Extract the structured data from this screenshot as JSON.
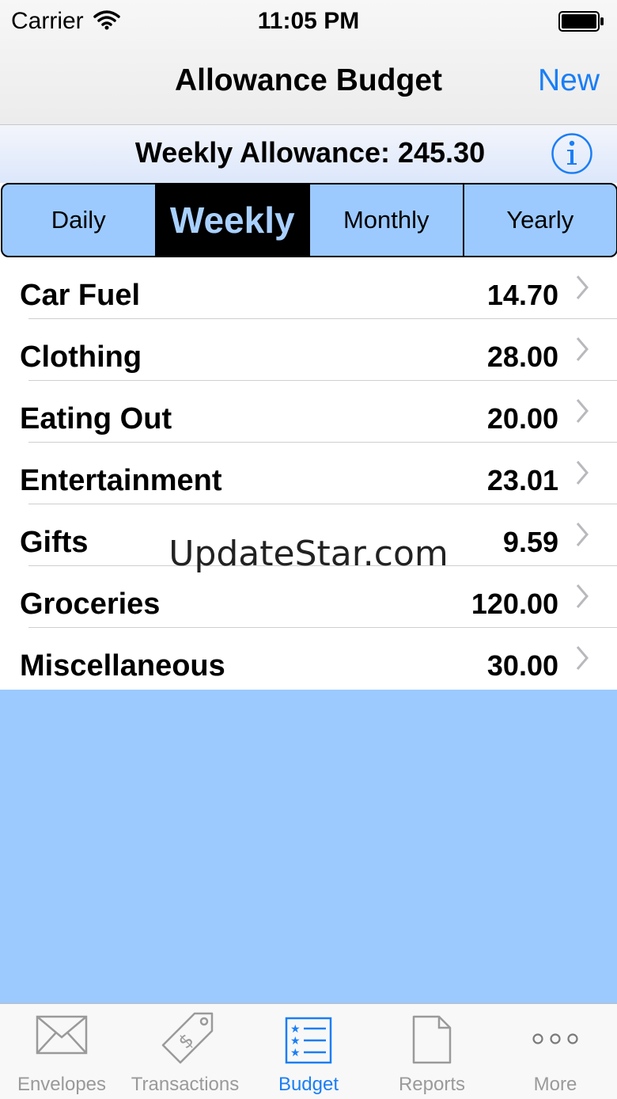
{
  "status": {
    "carrier": "Carrier",
    "time": "11:05 PM"
  },
  "nav": {
    "title": "Allowance Budget",
    "new_label": "New"
  },
  "allowance": {
    "text": "Weekly Allowance: 245.30"
  },
  "segments": [
    "Daily",
    "Weekly",
    "Monthly",
    "Yearly"
  ],
  "selected_segment": "Weekly",
  "budget_items": [
    {
      "name": "Car Fuel",
      "amount": "14.70"
    },
    {
      "name": "Clothing",
      "amount": "28.00"
    },
    {
      "name": "Eating Out",
      "amount": "20.00"
    },
    {
      "name": "Entertainment",
      "amount": "23.01"
    },
    {
      "name": "Gifts",
      "amount": "9.59"
    },
    {
      "name": "Groceries",
      "amount": "120.00"
    },
    {
      "name": "Miscellaneous",
      "amount": "30.00"
    }
  ],
  "watermark": "UpdateStar.com",
  "tabs": [
    {
      "label": "Envelopes",
      "icon": "envelope-icon"
    },
    {
      "label": "Transactions",
      "icon": "price-tag-icon"
    },
    {
      "label": "Budget",
      "icon": "budget-list-icon"
    },
    {
      "label": "Reports",
      "icon": "document-icon"
    },
    {
      "label": "More",
      "icon": "more-dots-icon"
    }
  ],
  "active_tab": "Budget",
  "colors": {
    "accent": "#1a7ef5",
    "segment_bg": "#9ccaff",
    "empty_area": "#9ccaff",
    "tab_inactive": "#9a9a9a"
  }
}
